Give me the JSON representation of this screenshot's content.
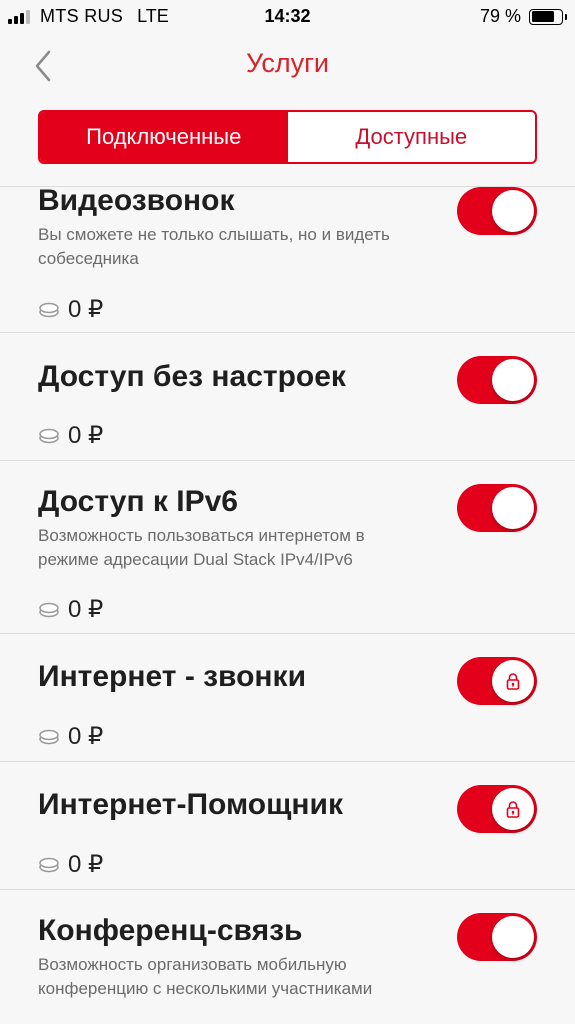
{
  "status_bar": {
    "carrier": "MTS RUS",
    "network": "LTE",
    "time": "14:32",
    "battery": "79 %",
    "battery_level": 0.79
  },
  "nav": {
    "title": "Услуги",
    "back_icon": "chevron-left-icon"
  },
  "tabs": [
    {
      "label": "Подключенные",
      "active": true
    },
    {
      "label": "Доступные",
      "active": false
    }
  ],
  "services": [
    {
      "title": "Видеозвонок",
      "description_lines": [
        "Вы сможете не только слышать, но и видеть",
        "собеседника"
      ],
      "price": "0 ₽",
      "enabled": true,
      "locked": false
    },
    {
      "title": "Доступ без настроек",
      "description_lines": [],
      "price": "0 ₽",
      "enabled": true,
      "locked": false
    },
    {
      "title": "Доступ к IPv6",
      "description_lines": [
        "Возможность пользоваться интернетом в",
        "режиме адресации Dual Stack IPv4/IPv6"
      ],
      "price": "0 ₽",
      "enabled": true,
      "locked": false
    },
    {
      "title": "Интернет - звонки",
      "description_lines": [],
      "price": "0 ₽",
      "enabled": true,
      "locked": true
    },
    {
      "title": "Интернет-Помощник",
      "description_lines": [],
      "price": "0 ₽",
      "enabled": true,
      "locked": true
    },
    {
      "title": "Конференц-связь",
      "description_lines": [
        "Возможность организовать мобильную",
        "конференцию с несколькими участниками"
      ],
      "price": "",
      "enabled": true,
      "locked": false
    }
  ],
  "colors": {
    "accent": "#e3001b",
    "title_red": "#d8232a",
    "background": "#f7f7f7"
  }
}
